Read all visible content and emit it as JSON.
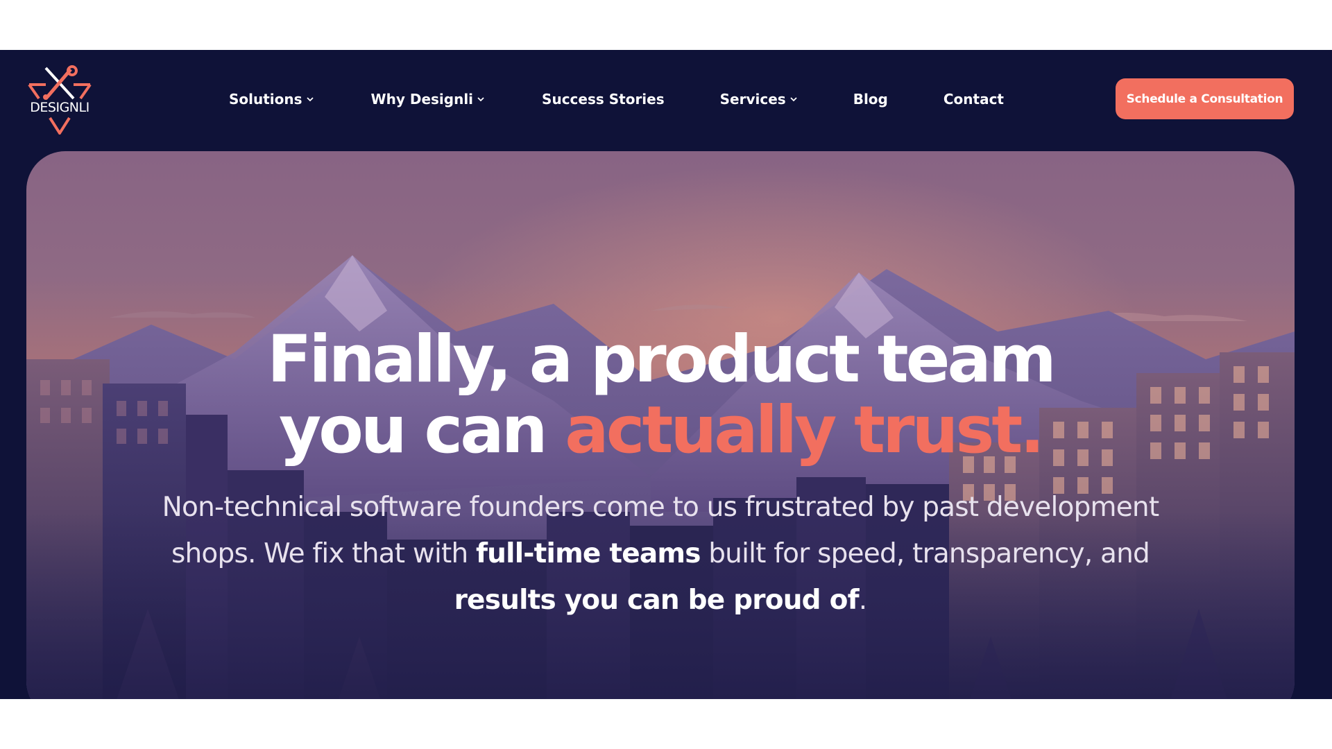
{
  "brand": {
    "name": "DESIGNLI",
    "accent_color": "#f26f5f",
    "nav_bg_color": "#0f1238",
    "logo_icon": "wrench-crossed-triangle-icon"
  },
  "nav": {
    "items": [
      {
        "label": "Solutions",
        "has_dropdown": true
      },
      {
        "label": "Why Designli",
        "has_dropdown": true
      },
      {
        "label": "Success Stories",
        "has_dropdown": false
      },
      {
        "label": "Services",
        "has_dropdown": true
      },
      {
        "label": "Blog",
        "has_dropdown": false
      },
      {
        "label": "Contact",
        "has_dropdown": false
      }
    ],
    "dropdown_icon": "chevron-down-icon",
    "cta_label": "Schedule a Consultation"
  },
  "hero": {
    "title_line1": "Finally, a product team",
    "title_line2_plain": "you can ",
    "title_line2_accent": "actually trust.",
    "subtitle_part1": "Non-technical software founders come to us frustrated by past development shops. We fix that with ",
    "subtitle_bold1": "full-time teams",
    "subtitle_part2": " built for speed, transparency, and ",
    "subtitle_bold2": "results you can be proud of",
    "subtitle_part3": "."
  }
}
